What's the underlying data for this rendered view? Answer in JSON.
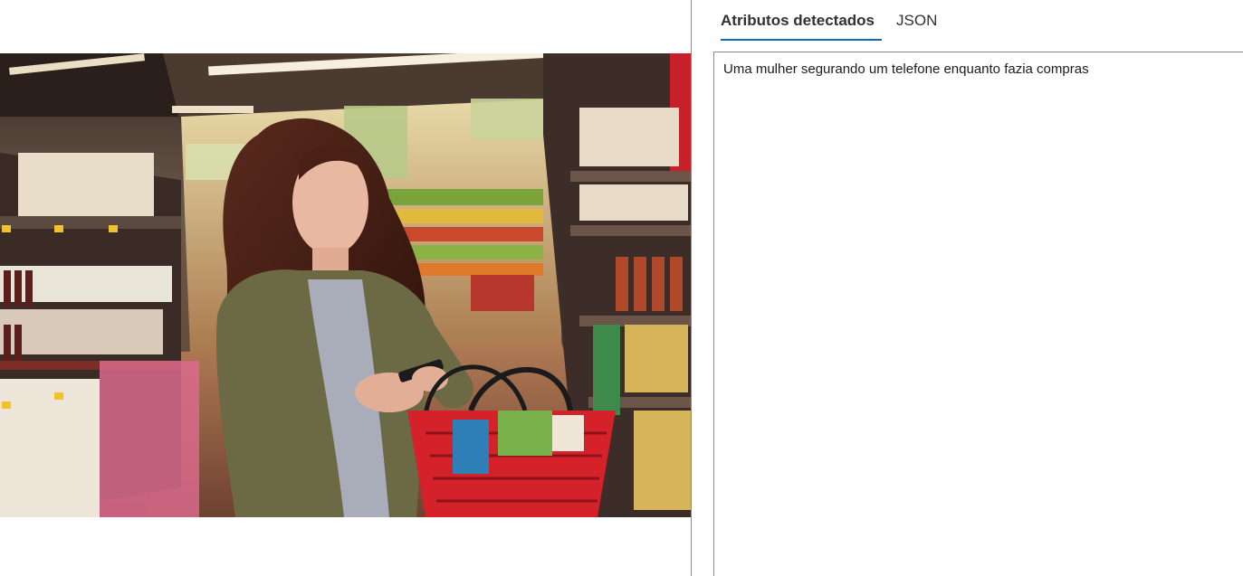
{
  "tabs": [
    {
      "label": "Atributos detectados",
      "active": true
    },
    {
      "label": "JSON",
      "active": false
    }
  ],
  "result": {
    "caption": "Uma mulher segurando um telefone enquanto fazia compras"
  },
  "image": {
    "icon": "grocery-shopping-photo"
  },
  "colors": {
    "accent": "#0f6cbd",
    "border": "#8a8a8a",
    "basket_red": "#d4212a"
  }
}
